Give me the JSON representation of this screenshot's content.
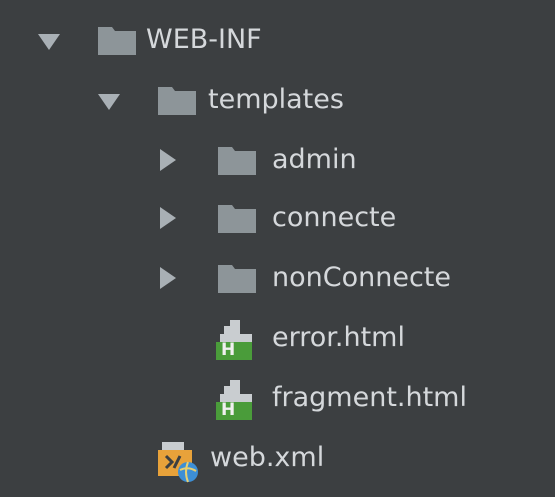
{
  "tree": {
    "items": [
      {
        "label": "WEB-INF",
        "type": "folder",
        "expanded": true,
        "level": 0,
        "icon": "folder-icon"
      },
      {
        "label": "templates",
        "type": "folder",
        "expanded": true,
        "level": 1,
        "icon": "folder-icon"
      },
      {
        "label": "admin",
        "type": "folder",
        "expanded": false,
        "level": 2,
        "icon": "folder-icon"
      },
      {
        "label": "connecte",
        "type": "folder",
        "expanded": false,
        "level": 2,
        "icon": "folder-icon"
      },
      {
        "label": "nonConnecte",
        "type": "folder",
        "expanded": false,
        "level": 2,
        "icon": "folder-icon"
      },
      {
        "label": "error.html",
        "type": "file",
        "level": 3,
        "icon": "html-file-icon",
        "badge": "H"
      },
      {
        "label": "fragment.html",
        "type": "file",
        "level": 3,
        "icon": "html-file-icon",
        "badge": "H"
      },
      {
        "label": "web.xml",
        "type": "file",
        "level": 2,
        "icon": "xml-web-file-icon"
      }
    ]
  },
  "colors": {
    "background": "#3c3f41",
    "text": "#d5d8db",
    "folder": "#8d9599",
    "arrow": "#a9b0b5",
    "html_badge": "#4a9c3a",
    "xml_accent": "#e8a23a",
    "globe": "#3d8fd6"
  }
}
